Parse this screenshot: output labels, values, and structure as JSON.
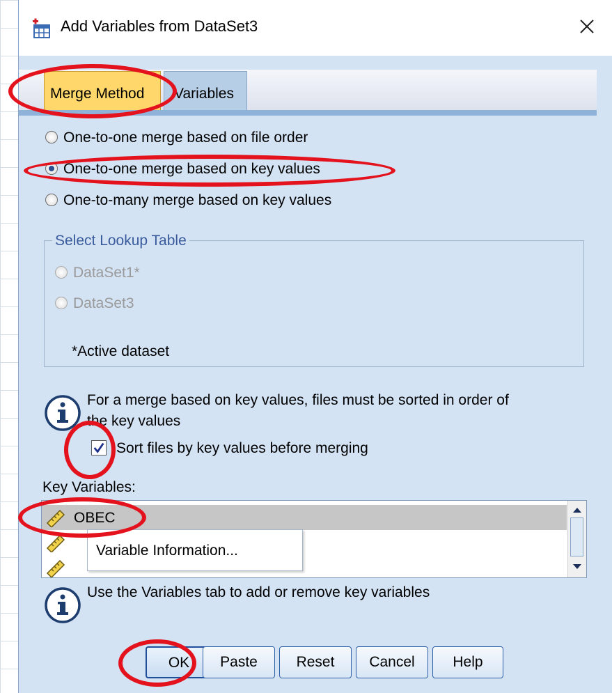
{
  "window": {
    "title": "Add Variables from DataSet3"
  },
  "tabs": [
    {
      "label": "Merge Method",
      "active": true
    },
    {
      "label": "Variables",
      "active": false
    }
  ],
  "merge_options": [
    {
      "label": "One-to-one merge based on file order",
      "selected": false
    },
    {
      "label": "One-to-one merge based on key values",
      "selected": true
    },
    {
      "label": "One-to-many merge based on key values",
      "selected": false
    }
  ],
  "lookup_table": {
    "legend": "Select Lookup Table",
    "options": [
      "DataSet1*",
      "DataSet3"
    ],
    "footnote": "*Active dataset",
    "enabled": false
  },
  "info": {
    "sort_note_line1": "For a merge based on key values, files must be sorted in order of",
    "sort_note_line2": "the key values",
    "variables_note": "Use the Variables tab to add or remove key variables"
  },
  "sort_checkbox": {
    "label": "Sort files by key values before merging",
    "checked": true
  },
  "key_variables": {
    "label": "Key Variables:",
    "items": [
      "OBEC",
      "",
      ""
    ]
  },
  "context_menu": {
    "item": "Variable Information..."
  },
  "buttons": {
    "ok": "OK",
    "paste": "Paste",
    "reset": "Reset",
    "cancel": "Cancel",
    "help": "Help"
  },
  "colors": {
    "dialog_bg": "#d3e3f4",
    "active_tab": "#ffd76b",
    "annotation": "#e4121d"
  }
}
